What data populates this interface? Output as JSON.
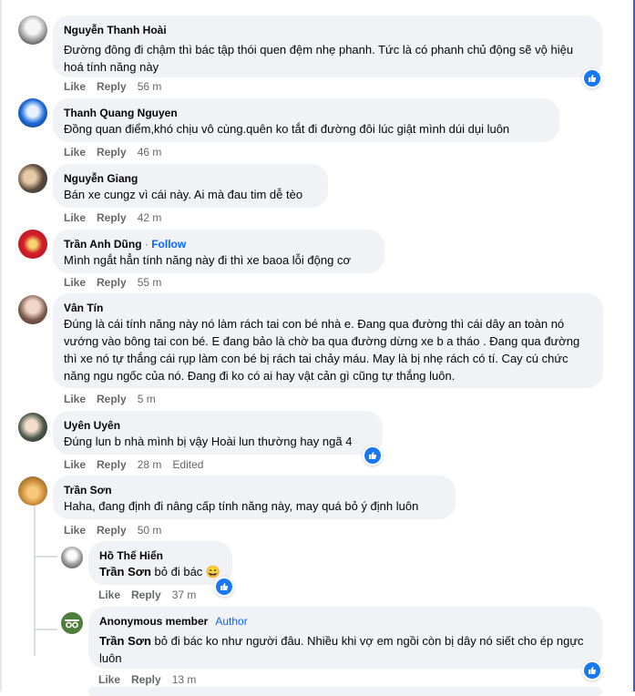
{
  "comments": [
    {
      "author": "Nguyễn Thanh Hoài",
      "text": "Đường đông đi chậm thì bác tập thói quen đệm nhẹ phanh. Tức là có phanh chủ động sẽ vộ hiệu hoá tính năng này",
      "like": "Like",
      "reply": "Reply",
      "time": "56 m"
    },
    {
      "author": "Thanh Quang Nguyen",
      "text": "Đồng quan điểm,khó chịu vô cùng.quên ko tắt đi đường đôi lúc giật mình dúi dụi luôn",
      "like": "Like",
      "reply": "Reply",
      "time": "46 m"
    },
    {
      "author": "Nguyễn Giang",
      "text": "Bán xe cungz vì cái này. Ai mà đau tim dễ tèo",
      "like": "Like",
      "reply": "Reply",
      "time": "42 m"
    },
    {
      "author": "Trần Anh Dũng",
      "author_sep": " · ",
      "follow": "Follow",
      "text": "Mình ngắt hẳn tính năng này đi thì xe baoa lỗi động cơ",
      "like": "Like",
      "reply": "Reply",
      "time": "55 m"
    },
    {
      "author": "Vân Tín",
      "text": "Đúng là cái tính năng này nó làm rách tai con bé nhà e. Đang qua đường thì cái dây an toàn nó vướng vào bông tai con bé. E đang bảo là chờ ba qua đường dừng xe b a tháo . Đang qua đường thì xe nó tự thắng cái rụp làm con bé bị rách tai chảy máu. May là bị nhẹ rách có tí. Cay cú chức năng ngu ngốc của nó. Đang đi ko có ai hay vật cản gì cũng tự thắng luôn.",
      "like": "Like",
      "reply": "Reply",
      "time": "5 m"
    },
    {
      "author": "Uyên Uyên",
      "text": "Đúng lun b nhà mình bị vậy Hoài lun thường hay ngã 4",
      "like": "Like",
      "reply": "Reply",
      "time": "28 m",
      "edited": "Edited"
    },
    {
      "author": "Trần Sơn",
      "text": "Haha, đang định đi nâng cấp tính năng này, may quá bỏ ý định luôn",
      "like": "Like",
      "reply": "Reply",
      "time": "50 m"
    }
  ],
  "replies": [
    {
      "author": "Hồ Thế Hiển",
      "mention": "Trần Sơn",
      "text": " bỏ đi bác ",
      "emoji": "😄",
      "like": "Like",
      "reply": "Reply",
      "time": "37 m"
    },
    {
      "author": "Anonymous member",
      "badge": "Author",
      "mention": "Trần Sơn",
      "text": " bỏ đi bác ko như người đâu. Nhiều khi vợ em ngồi còn bị dây nó siết cho ép ngực luôn",
      "like": "Like",
      "reply": "Reply",
      "time": "13 m"
    }
  ],
  "colors": {
    "like_blue": "#1877f2",
    "link_blue": "#0866ff",
    "bubble": "#f0f2f5",
    "meta": "#65676b"
  },
  "icons": {
    "reaction": "like-reaction-icon"
  }
}
